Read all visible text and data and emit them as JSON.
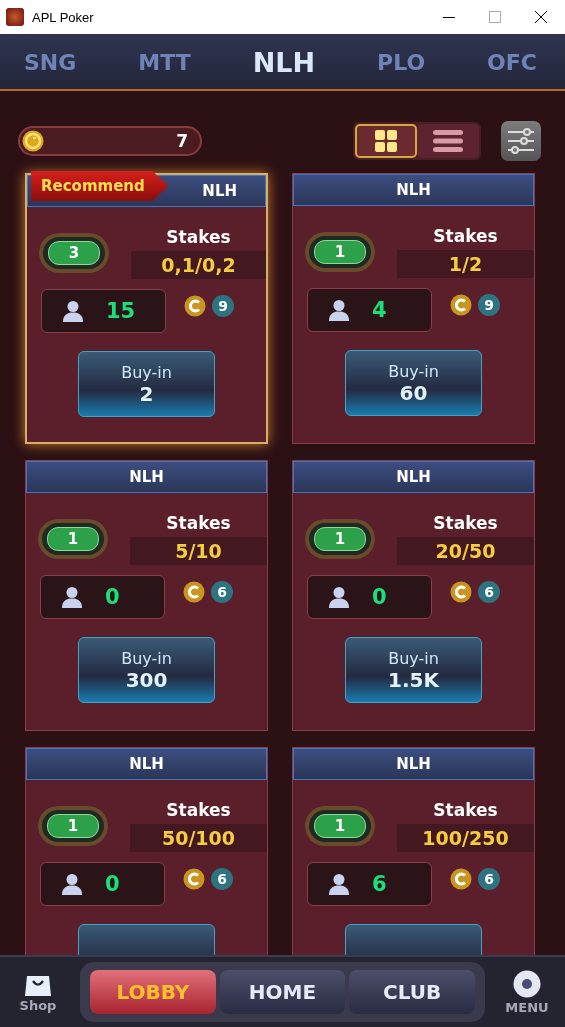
{
  "window": {
    "title": "APL Poker"
  },
  "tabs": [
    {
      "label": "SNG",
      "selected": false
    },
    {
      "label": "MTT",
      "selected": false
    },
    {
      "label": "NLH",
      "selected": true
    },
    {
      "label": "PLO",
      "selected": false
    },
    {
      "label": "OFC",
      "selected": false
    }
  ],
  "balance": {
    "value": "7"
  },
  "view_toggle": [
    {
      "kind": "grid",
      "selected": true
    },
    {
      "kind": "list",
      "selected": false
    }
  ],
  "tables": [
    {
      "game": "NLH",
      "recommended": true,
      "badge": "Recommend",
      "tables_count": "3",
      "stakes_label": "Stakes",
      "stakes": "0,1/0,2",
      "players": "15",
      "coin_count": "9",
      "buyin_label": "Buy-in",
      "buyin": "2"
    },
    {
      "game": "NLH",
      "recommended": false,
      "tables_count": "1",
      "stakes_label": "Stakes",
      "stakes": "1/2",
      "players": "4",
      "coin_count": "9",
      "buyin_label": "Buy-in",
      "buyin": "60"
    },
    {
      "game": "NLH",
      "recommended": false,
      "tables_count": "1",
      "stakes_label": "Stakes",
      "stakes": "5/10",
      "players": "0",
      "coin_count": "6",
      "buyin_label": "Buy-in",
      "buyin": "300"
    },
    {
      "game": "NLH",
      "recommended": false,
      "tables_count": "1",
      "stakes_label": "Stakes",
      "stakes": "20/50",
      "players": "0",
      "coin_count": "6",
      "buyin_label": "Buy-in",
      "buyin": "1.5K"
    },
    {
      "game": "NLH",
      "recommended": false,
      "tables_count": "1",
      "stakes_label": "Stakes",
      "stakes": "50/100",
      "players": "0",
      "coin_count": "6"
    },
    {
      "game": "NLH",
      "recommended": false,
      "tables_count": "1",
      "stakes_label": "Stakes",
      "stakes": "100/250",
      "players": "6",
      "coin_count": "6"
    }
  ],
  "bottom_nav": {
    "shop_label": "Shop",
    "tabs": [
      {
        "label": "LOBBY",
        "selected": true
      },
      {
        "label": "HOME",
        "selected": false
      },
      {
        "label": "CLUB",
        "selected": false
      }
    ],
    "menu_label": "MENU"
  }
}
